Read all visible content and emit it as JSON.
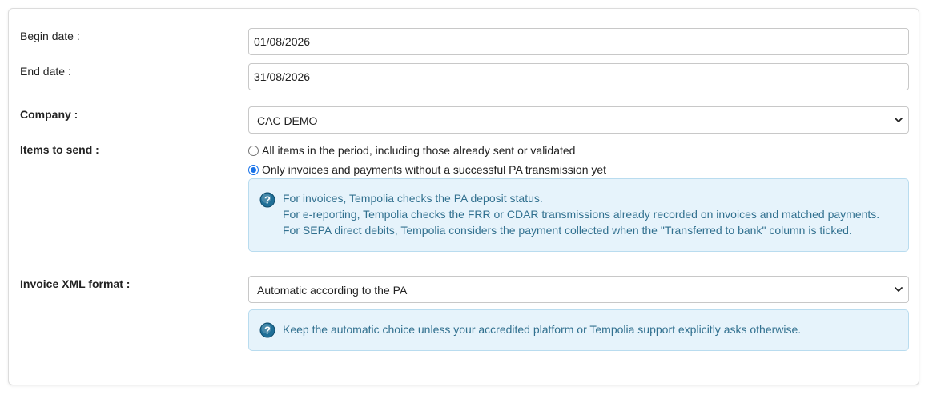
{
  "form": {
    "begin_date": {
      "label": "Begin date :",
      "value": "01/08/2026"
    },
    "end_date": {
      "label": "End date :",
      "value": "31/08/2026"
    },
    "company": {
      "label": "Company :",
      "selected": "CAC DEMO"
    },
    "items_to_send": {
      "label": "Items to send :",
      "options": [
        {
          "label": "All items in the period, including those already sent or validated",
          "checked": false
        },
        {
          "label": "Only invoices and payments without a successful PA transmission yet",
          "checked": true
        }
      ],
      "info_line1": "For invoices, Tempolia checks the PA deposit status.",
      "info_line2": "For e-reporting, Tempolia checks the FRR or CDAR transmissions already recorded on invoices and matched payments. For SEPA direct debits, Tempolia considers the payment collected when the \"Transferred to bank\" column is ticked."
    },
    "invoice_xml_format": {
      "label": "Invoice XML format :",
      "selected": "Automatic according to the PA",
      "info": "Keep the automatic choice unless your accredited platform or Tempolia support explicitly asks otherwise."
    }
  },
  "icons": {
    "help": "question-circle-icon",
    "select_arrow": "chevron-down-icon"
  },
  "colors": {
    "info_background": "#e6f3fb",
    "info_border": "#b9dcef",
    "info_text": "#31708f",
    "radio_accent": "#1a73e8"
  }
}
